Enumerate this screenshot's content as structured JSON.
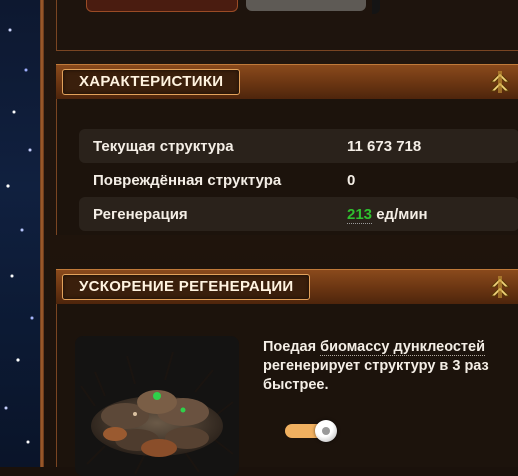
{
  "characteristics": {
    "title": "ХАРАКТЕРИСТИКИ",
    "rows": [
      {
        "label": "Текущая структура",
        "value": "11 673 718"
      },
      {
        "label": "Повреждённая структура",
        "value": "0"
      },
      {
        "label": "Регенерация",
        "value_number": "213",
        "value_unit": " ед/мин"
      }
    ]
  },
  "regen_boost": {
    "title": "УСКОРЕНИЕ РЕГЕНЕРАЦИИ",
    "text_before": "Поедая ",
    "text_link": "биомассу дунклеостей",
    "text_after": " регенерирует структуру в 3 раз быстрее.",
    "toggle_on": true
  },
  "colors": {
    "accent": "#e2a25c",
    "positive": "#2fbf2f",
    "toggle": "#f0b060"
  },
  "icons": {
    "collapse": "double-chevron-up-icon",
    "creature": "creature-swarm-icon"
  }
}
